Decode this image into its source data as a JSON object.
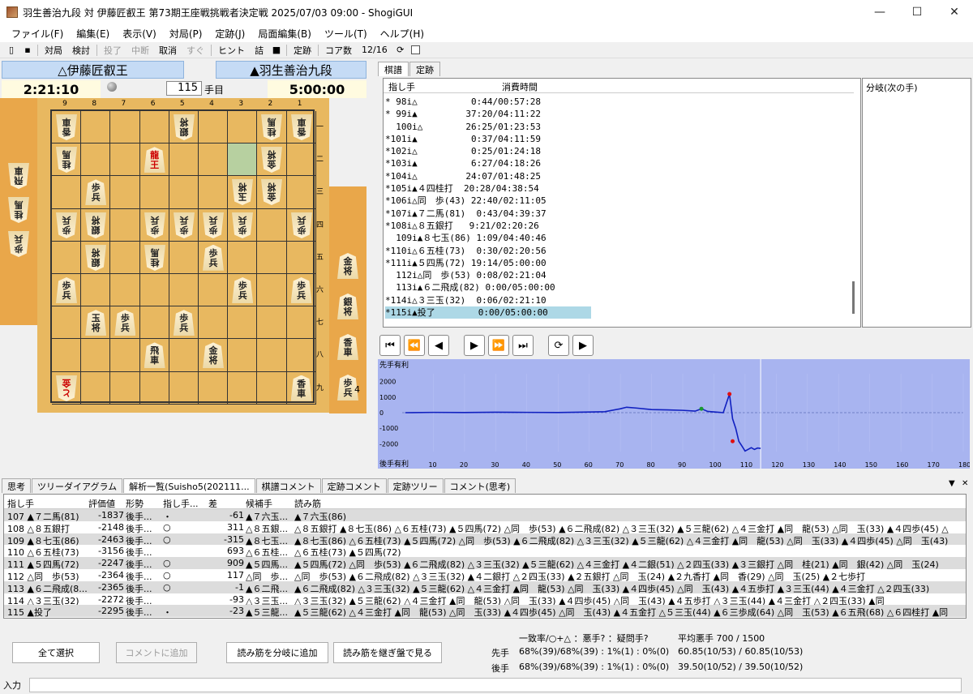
{
  "window": {
    "title": "羽生善治九段 対 伊藤匠叡王 第73期王座戦挑戦者決定戦 2025/07/03 09:00 - ShogiGUI",
    "minimize": "—",
    "maximize": "☐",
    "close": "✕"
  },
  "menu": [
    "ファイル(F)",
    "編集(E)",
    "表示(V)",
    "対局(P)",
    "定跡(J)",
    "局面編集(B)",
    "ツール(T)",
    "ヘルプ(H)"
  ],
  "toolbar": {
    "match": "対局",
    "study": "検討",
    "resign": "投了",
    "stop": "中断",
    "cancel": "取消",
    "now": "すぐ",
    "hint": "ヒント",
    "mate": "詰",
    "joseki": "定跡",
    "core_label": "コア数",
    "core_value": "12/16"
  },
  "players": {
    "gote_name": "△伊藤匠叡王",
    "sente_name": "▲羽生善治九段",
    "gote_time": "2:21:10",
    "sente_time": "5:00:00",
    "move_number": "115",
    "move_suffix": "手目"
  },
  "board": {
    "files": [
      "9",
      "8",
      "7",
      "6",
      "5",
      "4",
      "3",
      "2",
      "1"
    ],
    "ranks": [
      "一",
      "二",
      "三",
      "四",
      "五",
      "六",
      "七",
      "八",
      "九"
    ],
    "gote_hand": [
      [
        "飛",
        "車"
      ],
      [
        "桂",
        "馬"
      ],
      [
        "歩",
        "兵"
      ]
    ],
    "sente_hand": [
      [
        "金",
        "将"
      ],
      [
        "銀",
        "将"
      ],
      [
        "香",
        "車"
      ],
      [
        "歩",
        "兵"
      ]
    ],
    "sente_hand_count": "4"
  },
  "right_tabs": [
    "棋譜",
    "定跡"
  ],
  "kifu": {
    "col_move": "指し手",
    "col_time": "消費時間",
    "rows": [
      "* 98i△          0:44/00:57:28",
      "* 99i▲         37:20/04:11:22",
      "  100i△        26:25/01:23:53",
      "*101i▲          0:37/04:11:59",
      "*102i△          0:25/01:24:18",
      "*103i▲          6:27/04:18:26",
      "*104i△         24:07/01:48:25",
      "*105i▲４四桂打  20:28/04:38:54",
      "*106i△同　歩(43) 22:40/02:11:05",
      "*107i▲７二馬(81)  0:43/04:39:37",
      "*108i△８五銀打   9:21/02:20:26",
      "  109i▲８七玉(86) 1:09/04:40:46",
      "*110i△６五桂(73)  0:30/02:20:56",
      "*111i▲５四馬(72) 19:14/05:00:00",
      "  112i△同　歩(53) 0:08/02:21:04",
      "  113i▲６二飛成(82) 0:00/05:00:00",
      "*114i△３三玉(32)  0:06/02:21:10",
      "*115i▲投了        0:00/05:00:00"
    ]
  },
  "branch_title": "分岐(次の手)",
  "nav": [
    "⏮",
    "⏪",
    "◀",
    "▶",
    "⏩",
    "⏭",
    "⟳",
    "▶"
  ],
  "graph": {
    "top_label": "先手有利",
    "bottom_label": "後手有利",
    "y_ticks": [
      "2000",
      "1000",
      "0",
      "-1000",
      "-2000"
    ],
    "x_ticks": [
      "10",
      "20",
      "30",
      "40",
      "50",
      "60",
      "70",
      "80",
      "90",
      "100",
      "110",
      "120",
      "130",
      "140",
      "150",
      "160",
      "170",
      "180"
    ]
  },
  "chart_data": {
    "type": "line",
    "title": "",
    "ylim": [
      -2500,
      2500
    ],
    "xlim": [
      0,
      180
    ],
    "x": [
      1,
      10,
      20,
      30,
      40,
      50,
      60,
      65,
      70,
      72,
      75,
      80,
      85,
      90,
      94,
      96,
      98,
      100,
      103,
      105,
      106,
      107,
      108,
      109,
      110,
      112,
      113,
      114,
      115
    ],
    "values": [
      0,
      20,
      10,
      30,
      20,
      10,
      40,
      60,
      250,
      350,
      300,
      200,
      180,
      150,
      100,
      250,
      80,
      50,
      0,
      1200,
      -400,
      -1000,
      -1837,
      -2148,
      -2463,
      -2247,
      -2365,
      -2272,
      -2295
    ]
  },
  "bottom_tabs": [
    "思考",
    "ツリーダイアグラム",
    "解析一覧(Suisho5(202111...",
    "棋譜コメント",
    "定跡コメント",
    "定跡ツリー",
    "コメント(思考)"
  ],
  "analysis": {
    "headers": [
      "指し手",
      "評価値",
      "形勢",
      "指し手...",
      "差",
      "候補手",
      "読み筋"
    ],
    "rows": [
      [
        "107 ▲７二馬(81)",
        "-1837",
        "後手...",
        "・",
        "-61",
        "▲７六玉...",
        "▲７六玉(86)"
      ],
      [
        "108 △８五銀打",
        "-2148",
        "後手...",
        "○",
        "311",
        "△８五銀...",
        "△８五銀打 ▲８七玉(86) △６五桂(73) ▲５四馬(72) △同　歩(53) ▲６二飛成(82) △３三玉(32) ▲５三龍(62) △４三金打 ▲同　龍(53) △同　玉(33) ▲４四歩(45) △"
      ],
      [
        "109 ▲８七玉(86)",
        "-2463",
        "後手...",
        "○",
        "-315",
        "▲８七玉...",
        "▲８七玉(86) △６五桂(73) ▲５四馬(72) △同　歩(53) ▲６二飛成(82) △３三玉(32) ▲５三龍(62) △４三金打 ▲同　龍(53) △同　玉(33) ▲４四歩(45) △同　玉(43)"
      ],
      [
        "110 △６五桂(73)",
        "-3156",
        "後手...",
        "",
        "693",
        "△６五桂...",
        "△６五桂(73) ▲５四馬(72)"
      ],
      [
        "111 ▲５四馬(72)",
        "-2247",
        "後手...",
        "○",
        "909",
        "▲５四馬...",
        "▲５四馬(72) △同　歩(53) ▲６二飛成(82) △３三玉(32) ▲５三龍(62) △４三金打 ▲４二銀(51) △２四玉(33) ▲３三銀打 △同　桂(21) ▲同　銀(42) △同　玉(24)"
      ],
      [
        "112 △同　歩(53)",
        "-2364",
        "後手...",
        "○",
        "117",
        "△同　歩...",
        "△同　歩(53) ▲６二飛成(82) △３三玉(32) ▲４二銀打 △２四玉(33) ▲２五銀打 △同　玉(24) ▲２九香打 ▲同　香(29) △同　玉(25) ▲２七歩打"
      ],
      [
        "113 ▲６二飛成(8...",
        "-2365",
        "後手...",
        "○",
        "-1",
        "▲６二飛...",
        "▲６二飛成(82) △３三玉(32) ▲５三龍(62) △４三金打 ▲同　龍(53) △同　玉(33) ▲４四歩(45) △同　玉(43) ▲４五歩打 ▲３三玉(44) ▲４三金打 △２四玉(33)"
      ],
      [
        "114 △３三玉(32)",
        "-2272",
        "後手...",
        "",
        "-93",
        "△３三玉...",
        "△３三玉(32) ▲５三龍(62) △４三金打 ▲同　龍(53) △同　玉(33) ▲４四歩(45) △同　玉(43) ▲４五歩打 △３三玉(44) ▲４三金打 △２四玉(33) ▲同　"
      ],
      [
        "115 ▲投了",
        "-2295",
        "後手...",
        "・",
        "-23",
        "▲５三龍...",
        "▲５三龍(62) △４三金打 ▲同　龍(53) △同　玉(33) ▲４四歩(45) △同　玉(43) ▲４五金打 △５三玉(44) ▲６三歩成(64) △同　玉(53) ▲６五飛(68) △６四桂打 ▲同　"
      ]
    ]
  },
  "buttons": {
    "select_all": "全て選択",
    "add_comment": "コメントに追加",
    "add_pv_branch": "読み筋を分岐に追加",
    "view_pv_board": "読み筋を継ぎ盤で見る"
  },
  "stats": {
    "header": "一致率/○+△ ：悪手? ：疑問手?",
    "avg_header": "平均悪手 700 / 1500",
    "sente_label": "先手",
    "sente_value": "68%(39)/68%(39) : 1%(1) : 0%(0)",
    "sente_avg": "60.85(10/53) / 60.85(10/53)",
    "gote_label": "後手",
    "gote_value": "68%(39)/68%(39) : 1%(1) : 0%(0)",
    "gote_avg": "39.50(10/52) / 39.50(10/52)"
  },
  "input_label": "入力"
}
